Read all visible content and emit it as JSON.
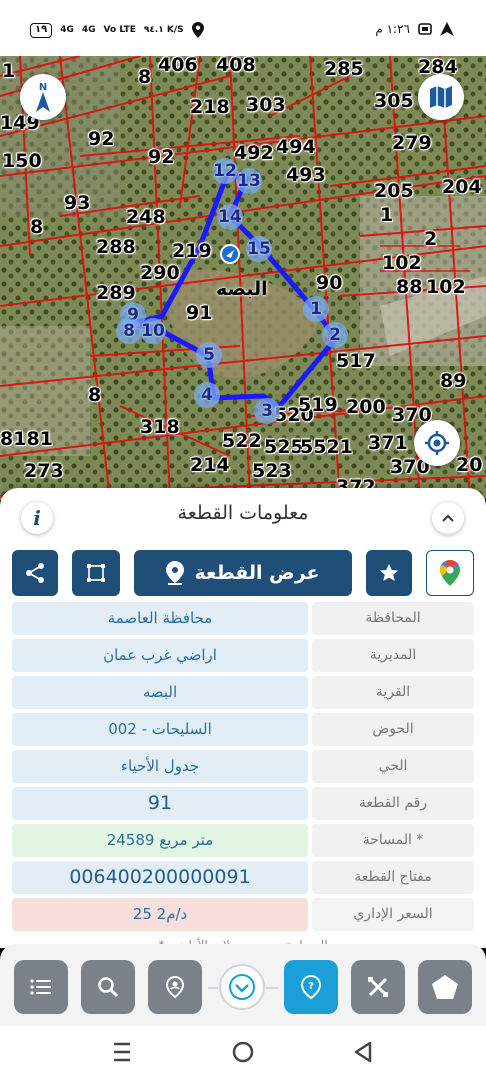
{
  "status_bar": {
    "time": "١:٢٦ م",
    "battery": "١٩",
    "network": "4G",
    "network2": "4G",
    "volte": "Vo LTE",
    "speed": "٩٤.١ K/S"
  },
  "map": {
    "village_label": "البصه",
    "parcels": [
      "406",
      "408",
      "285",
      "284",
      "8",
      "1",
      "218",
      "303",
      "305",
      "149",
      "92",
      "279",
      "92",
      "492",
      "494",
      "150",
      "493",
      "205",
      "204",
      "93",
      "8",
      "248",
      "1",
      "2",
      "288",
      "219",
      "102",
      "290",
      "90",
      "88",
      "102",
      "289",
      "91",
      "9",
      "8",
      "10",
      "517",
      "89",
      "8",
      "318",
      "520",
      "519",
      "200",
      "370",
      "8181",
      "522",
      "525",
      "5521",
      "371",
      "273",
      "214",
      "523",
      "372",
      "370",
      "20"
    ],
    "vertices": [
      "12",
      "13",
      "14",
      "15",
      "1",
      "2",
      "3",
      "4",
      "5",
      "9",
      "8",
      "10"
    ]
  },
  "panel": {
    "title": "معلومات القطعة",
    "view_button_label": "عرض القطعة",
    "rows": [
      {
        "label": "المحافظة",
        "value": "محافظة العاصمة"
      },
      {
        "label": "المديرية",
        "value": "اراضي غرب عمان"
      },
      {
        "label": "القرية",
        "value": "البصه"
      },
      {
        "label": "الحوض",
        "value": "السليحات - 002"
      },
      {
        "label": "الحي",
        "value": "جدول الأحياء"
      },
      {
        "label": "رقم القطعة",
        "value": "91"
      },
      {
        "label": "المساحة *",
        "value": "24589  متر مربع"
      },
      {
        "label": "مفتاح القطعة",
        "value": "006400200000091"
      },
      {
        "label": "السعر الإداري",
        "value": "25 د/م2"
      }
    ],
    "footnote": "* المساحة حسب سجلات الأراضي"
  },
  "colors": {
    "primary": "#1f4e79",
    "accent": "#1a9fd8",
    "toolbar_button": "#7b8189",
    "boundary": "#1a1aff",
    "parcel_lines": "#e01010"
  },
  "icons": {
    "compass": "compass-icon",
    "map_layers": "map-layers-icon",
    "locate": "locate-icon",
    "info": "info-icon",
    "collapse": "chevron-up-icon",
    "google_maps": "google-maps-icon",
    "favorite": "star-icon",
    "view": "location-pin-icon",
    "draw": "polygon-icon",
    "share": "share-icon"
  }
}
